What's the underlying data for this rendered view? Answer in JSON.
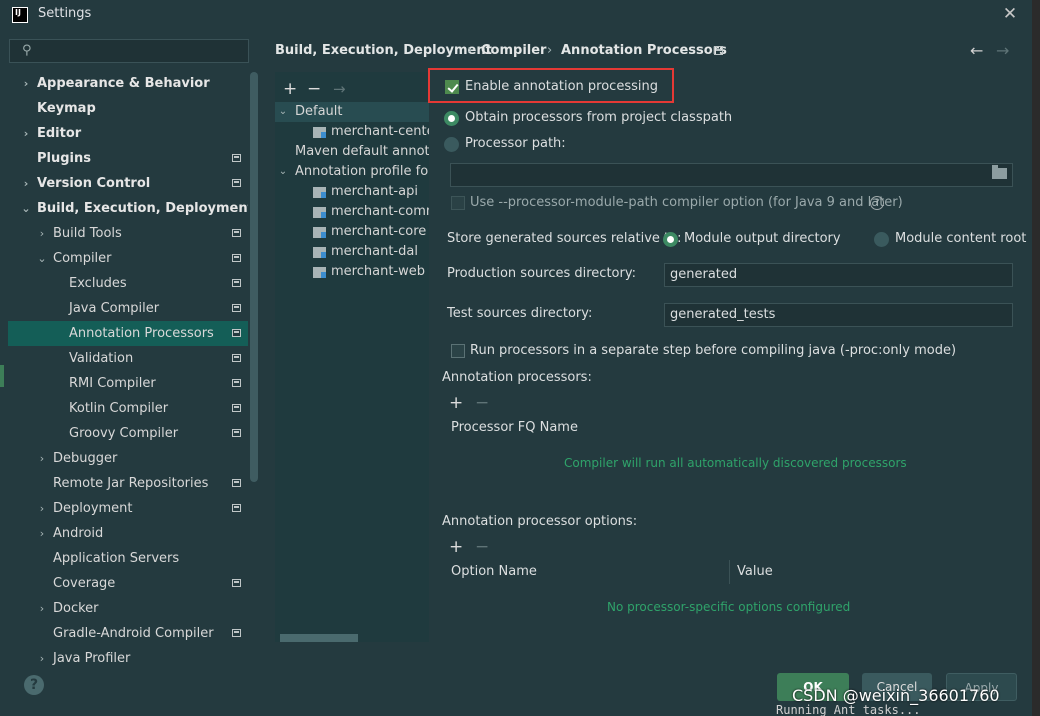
{
  "window": {
    "title": "Settings",
    "app_icon_text": "IJ",
    "close_glyph": "✕"
  },
  "search": {
    "placeholder": ""
  },
  "sidebar": {
    "items": [
      {
        "label": "Appearance & Behavior",
        "bold": true,
        "arrow": "›",
        "level": 0,
        "mark": false
      },
      {
        "label": "Keymap",
        "bold": true,
        "arrow": "",
        "level": 0,
        "mark": false
      },
      {
        "label": "Editor",
        "bold": true,
        "arrow": "›",
        "level": 0,
        "mark": false
      },
      {
        "label": "Plugins",
        "bold": true,
        "arrow": "",
        "level": 0,
        "mark": true
      },
      {
        "label": "Version Control",
        "bold": true,
        "arrow": "›",
        "level": 0,
        "mark": true
      },
      {
        "label": "Build, Execution, Deployment",
        "bold": true,
        "arrow": "⌄",
        "level": 0,
        "mark": false
      },
      {
        "label": "Build Tools",
        "bold": false,
        "arrow": "›",
        "level": 1,
        "mark": true
      },
      {
        "label": "Compiler",
        "bold": false,
        "arrow": "⌄",
        "level": 1,
        "mark": true
      },
      {
        "label": "Excludes",
        "bold": false,
        "arrow": "",
        "level": 2,
        "mark": true
      },
      {
        "label": "Java Compiler",
        "bold": false,
        "arrow": "",
        "level": 2,
        "mark": true
      },
      {
        "label": "Annotation Processors",
        "bold": false,
        "arrow": "",
        "level": 2,
        "mark": true,
        "selected": true
      },
      {
        "label": "Validation",
        "bold": false,
        "arrow": "",
        "level": 2,
        "mark": true
      },
      {
        "label": "RMI Compiler",
        "bold": false,
        "arrow": "",
        "level": 2,
        "mark": true
      },
      {
        "label": "Kotlin Compiler",
        "bold": false,
        "arrow": "",
        "level": 2,
        "mark": true
      },
      {
        "label": "Groovy Compiler",
        "bold": false,
        "arrow": "",
        "level": 2,
        "mark": true
      },
      {
        "label": "Debugger",
        "bold": false,
        "arrow": "›",
        "level": 1,
        "mark": false
      },
      {
        "label": "Remote Jar Repositories",
        "bold": false,
        "arrow": "",
        "level": 1,
        "mark": true
      },
      {
        "label": "Deployment",
        "bold": false,
        "arrow": "›",
        "level": 1,
        "mark": true
      },
      {
        "label": "Android",
        "bold": false,
        "arrow": "›",
        "level": 1,
        "mark": false
      },
      {
        "label": "Application Servers",
        "bold": false,
        "arrow": "",
        "level": 1,
        "mark": false
      },
      {
        "label": "Coverage",
        "bold": false,
        "arrow": "",
        "level": 1,
        "mark": true
      },
      {
        "label": "Docker",
        "bold": false,
        "arrow": "›",
        "level": 1,
        "mark": false
      },
      {
        "label": "Gradle-Android Compiler",
        "bold": false,
        "arrow": "",
        "level": 1,
        "mark": true
      },
      {
        "label": "Java Profiler",
        "bold": false,
        "arrow": "›",
        "level": 1,
        "mark": false
      }
    ]
  },
  "breadcrumb": {
    "part1": "Build, Execution, Deployment",
    "part2": "Compiler",
    "part3": "Annotation Processors",
    "sep": "›",
    "back": "←",
    "forward": "→"
  },
  "profiles": {
    "toolbar": {
      "add": "+",
      "remove": "−",
      "move": "→"
    },
    "items": [
      {
        "label": "Default",
        "arrow": "⌄",
        "indent": 0,
        "icon": false,
        "selected": true
      },
      {
        "label": "merchant-center",
        "arrow": "",
        "indent": 2,
        "icon": true
      },
      {
        "label": "Maven default annotati",
        "arrow": "",
        "indent": 1,
        "icon": false
      },
      {
        "label": "Annotation profile for r",
        "arrow": "⌄",
        "indent": 0,
        "icon": false
      },
      {
        "label": "merchant-api",
        "arrow": "",
        "indent": 2,
        "icon": true
      },
      {
        "label": "merchant-comm",
        "arrow": "",
        "indent": 2,
        "icon": true
      },
      {
        "label": "merchant-core",
        "arrow": "",
        "indent": 2,
        "icon": true
      },
      {
        "label": "merchant-dal",
        "arrow": "",
        "indent": 2,
        "icon": true
      },
      {
        "label": "merchant-web",
        "arrow": "",
        "indent": 2,
        "icon": true
      }
    ]
  },
  "settings": {
    "enable_annotation": {
      "label": "Enable annotation processing",
      "checked": true
    },
    "obtain_classpath": {
      "label": "Obtain processors from project classpath",
      "selected": true
    },
    "processor_path": {
      "label": "Processor path:",
      "selected": false,
      "value": ""
    },
    "processor_module_path": {
      "label": "Use --processor-module-path compiler option (for Java 9 and later)",
      "checked": false,
      "help": "?"
    },
    "store_generated": {
      "label": "Store generated sources relative to:",
      "option1": "Module output directory",
      "option2": "Module content root"
    },
    "production_dir": {
      "label": "Production sources directory:",
      "value": "generated"
    },
    "test_dir": {
      "label": "Test sources directory:",
      "value": "generated_tests"
    },
    "run_separate": {
      "label": "Run processors in a separate step before compiling java (-proc:only mode)",
      "checked": false
    },
    "annotation_processors": {
      "label": "Annotation processors:",
      "add": "+",
      "remove": "−",
      "column": "Processor FQ Name",
      "empty": "Compiler will run all automatically discovered processors"
    },
    "processor_options": {
      "label": "Annotation processor options:",
      "add": "+",
      "remove": "−",
      "col_name": "Option Name",
      "col_value": "Value",
      "empty": "No processor-specific options configured"
    }
  },
  "buttons": {
    "ok": "OK",
    "cancel": "Cancel",
    "apply": "Apply",
    "help": "?"
  },
  "background": {
    "console": "Running Ant tasks...",
    "csdn": "CSDN @weixin_36601760"
  },
  "colors": {
    "accent_selected": "#145e57",
    "highlight_box": "#e53935",
    "empty_message": "#2fa36a"
  }
}
